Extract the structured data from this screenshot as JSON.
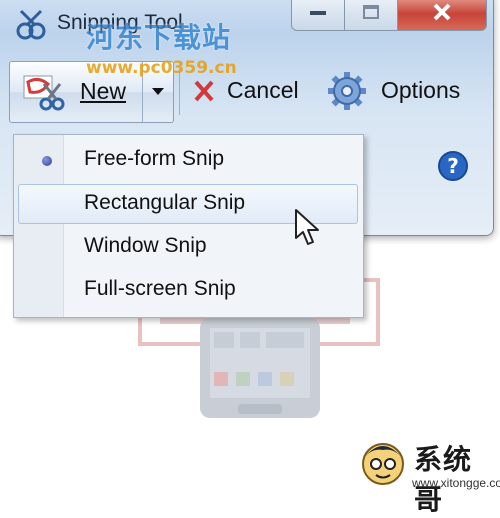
{
  "window": {
    "title": "Snipping Tool"
  },
  "watermark": {
    "site_name": "河东下载站",
    "url": "www.pc0359.cn"
  },
  "toolbar": {
    "new_label": "New",
    "cancel_label": "Cancel",
    "options_label": "Options"
  },
  "menu": {
    "items": [
      {
        "label": "Free-form Snip",
        "selected": true
      },
      {
        "label": "Rectangular Snip",
        "hovered": true
      },
      {
        "label": "Window Snip"
      },
      {
        "label": "Full-screen Snip"
      }
    ]
  },
  "logo": {
    "text": "系统哥",
    "url": "www.xitongge.com"
  },
  "icons": [
    "snipping-tool-icon",
    "minimize-icon",
    "maximize-icon",
    "close-icon",
    "scissors-icon",
    "dropdown-arrow-icon",
    "cancel-x-icon",
    "gear-icon",
    "help-icon",
    "mouse-cursor-icon"
  ],
  "colors": {
    "close_button": "#c8443a",
    "watermark_blue": "#2b7fd0",
    "watermark_orange": "#e7a21a",
    "help_blue": "#1f5fbf"
  }
}
